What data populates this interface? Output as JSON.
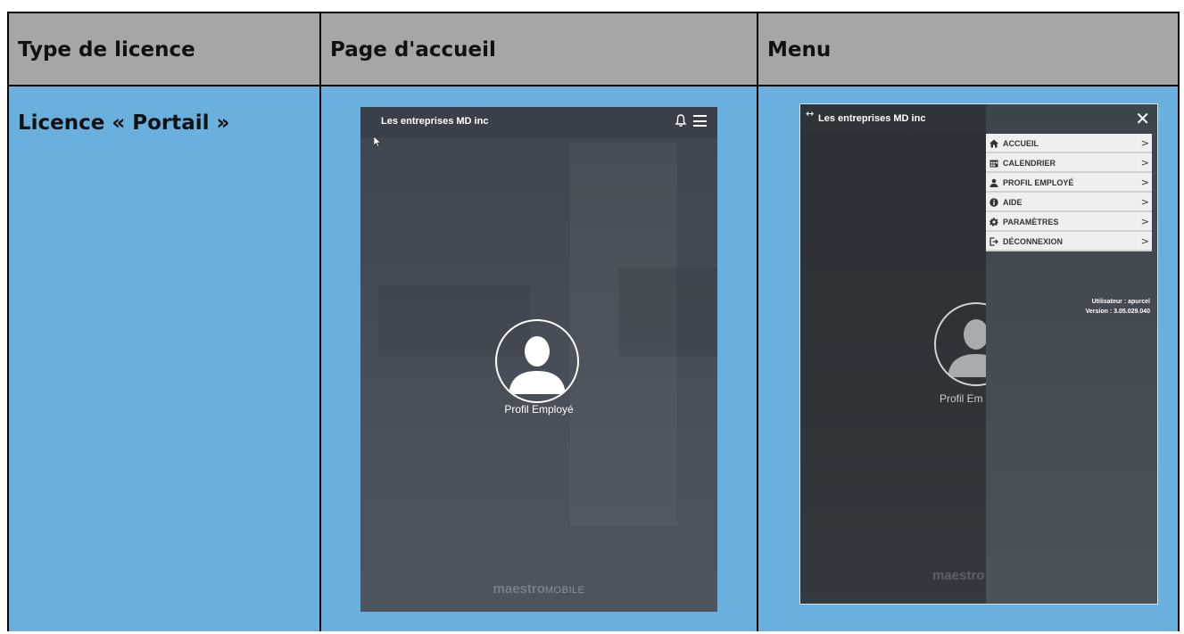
{
  "table": {
    "headers": [
      "Type de licence",
      "Page d'accueil",
      "Menu"
    ],
    "license_type": "Licence « Portail »"
  },
  "home_screen": {
    "company": "Les entreprises MD inc",
    "profile_label": "Profil Employé",
    "brand_main": "maestro",
    "brand_sub": "MOBILE"
  },
  "menu_screen": {
    "arrow_glyph": "↔",
    "company": "Les entreprises MD inc",
    "close_glyph": "✕",
    "background_profile_label": "Profil Em",
    "background_brand": "maestro",
    "items": [
      {
        "label": "ACCUEIL",
        "icon": "home-icon"
      },
      {
        "label": "CALENDRIER",
        "icon": "calendar-icon"
      },
      {
        "label": "PROFIL EMPLOYÉ",
        "icon": "user-icon"
      },
      {
        "label": "AIDE",
        "icon": "info-icon"
      },
      {
        "label": "PARAMÈTRES",
        "icon": "gear-icon"
      },
      {
        "label": "DÉCONNEXION",
        "icon": "logout-icon"
      }
    ],
    "chevron": ">",
    "user_line": "Utilisateur : apurcel",
    "version_line": "Version : 3.05.029.040"
  }
}
